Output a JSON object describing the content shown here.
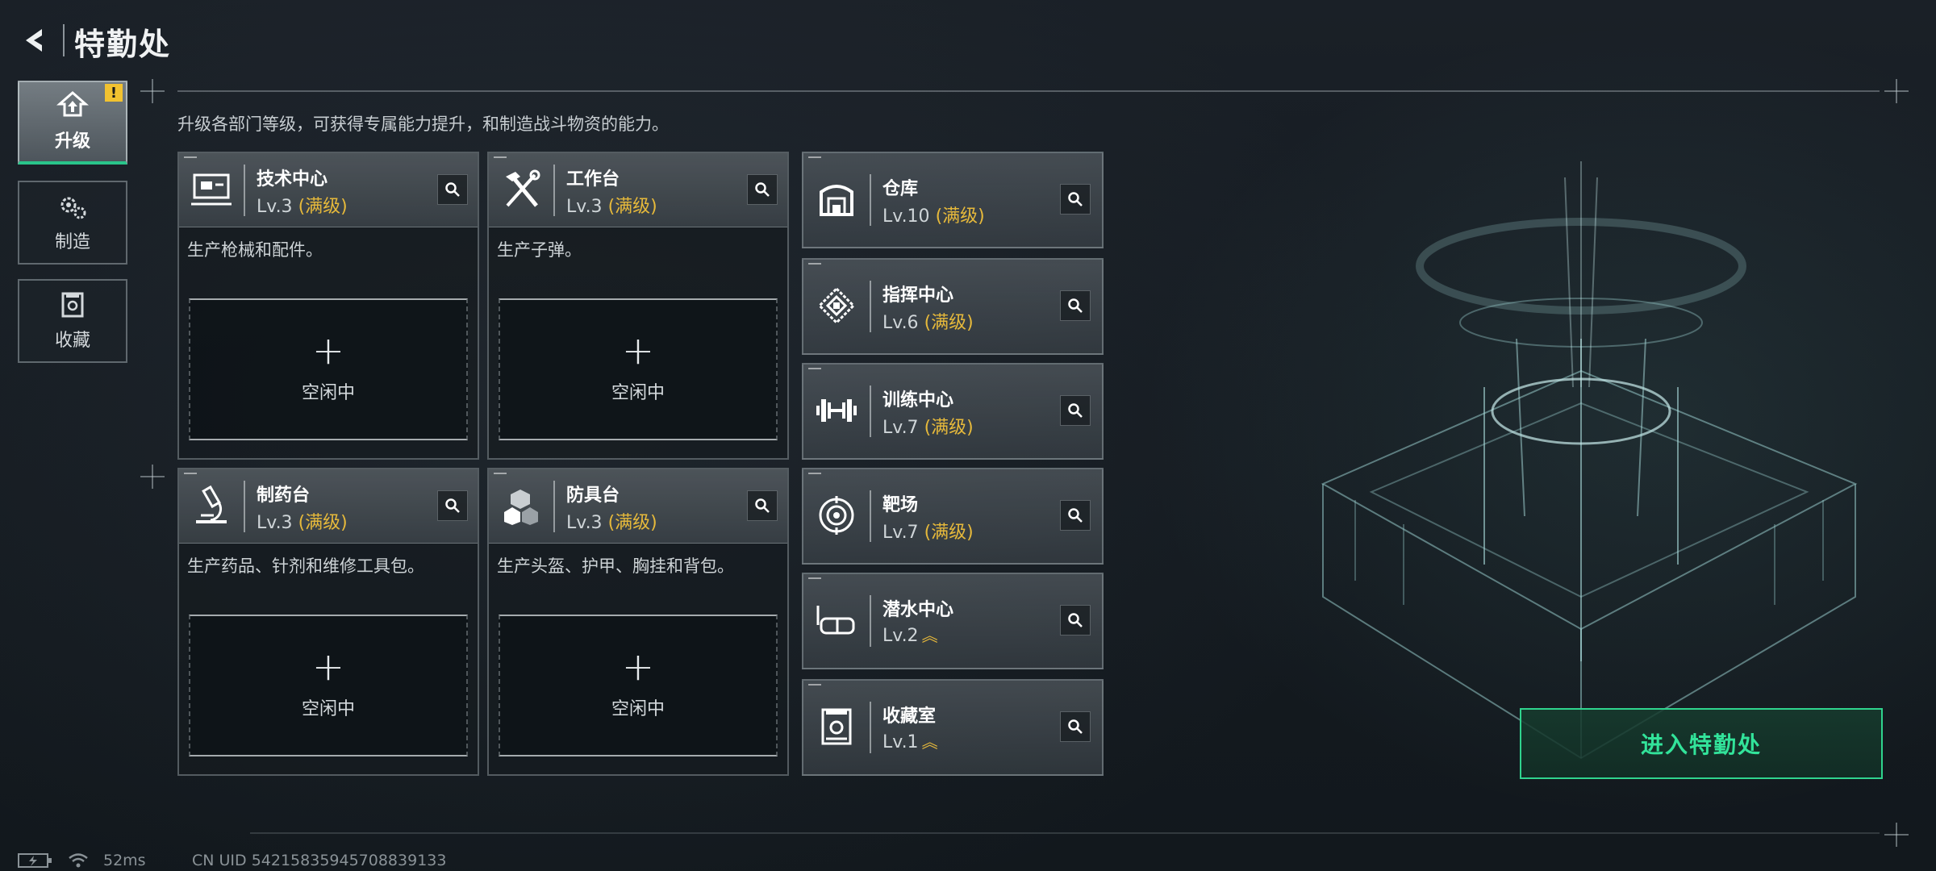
{
  "header": {
    "title": "特勤处"
  },
  "nav": [
    {
      "label": "升级",
      "icon": "upgrade-icon",
      "active": true,
      "alert": "!"
    },
    {
      "label": "制造",
      "icon": "gears-icon",
      "active": false
    },
    {
      "label": "收藏",
      "icon": "collection-icon",
      "active": false
    }
  ],
  "subtitle": "升级各部门等级，可获得专属能力提升，和制造战斗物资的能力。",
  "cards": [
    {
      "name": "技术中心",
      "level": "Lv.3",
      "status": "(满级)",
      "desc": "生产枪械和配件。",
      "slot_plus": "+",
      "slot_label": "空闲中",
      "icon": "computer-icon"
    },
    {
      "name": "工作台",
      "level": "Lv.3",
      "status": "(满级)",
      "desc": "生产子弹。",
      "slot_plus": "+",
      "slot_label": "空闲中",
      "icon": "tools-icon"
    },
    {
      "name": "制药台",
      "level": "Lv.3",
      "status": "(满级)",
      "desc": "生产药品、针剂和维修工具包。",
      "slot_plus": "+",
      "slot_label": "空闲中",
      "icon": "microscope-icon"
    },
    {
      "name": "防具台",
      "level": "Lv.3",
      "status": "(满级)",
      "desc": "生产头盔、护甲、胸挂和背包。",
      "slot_plus": "+",
      "slot_label": "空闲中",
      "icon": "armor-cubes-icon"
    }
  ],
  "facilities": [
    {
      "name": "仓库",
      "level": "Lv.10",
      "status": "(满级)",
      "icon": "warehouse-icon"
    },
    {
      "name": "指挥中心",
      "level": "Lv.6",
      "status": "(满级)",
      "icon": "chip-icon"
    },
    {
      "name": "训练中心",
      "level": "Lv.7",
      "status": "(满级)",
      "icon": "dumbbell-icon"
    },
    {
      "name": "靶场",
      "level": "Lv.7",
      "status": "(满级)",
      "icon": "target-icon"
    },
    {
      "name": "潜水中心",
      "level": "Lv.2",
      "status": "",
      "upgradable": true,
      "icon": "diving-mask-icon"
    },
    {
      "name": "收藏室",
      "level": "Lv.1",
      "status": "",
      "upgradable": true,
      "icon": "display-case-icon"
    }
  ],
  "enter_button": "进入特勤处",
  "status_bar": {
    "ping": "52ms",
    "uid": "CN UID 54215835945708839133"
  },
  "colors": {
    "accent_green": "#2fd48e",
    "maxed_gold": "#e6b93b",
    "alert_yellow": "#f2c230"
  }
}
